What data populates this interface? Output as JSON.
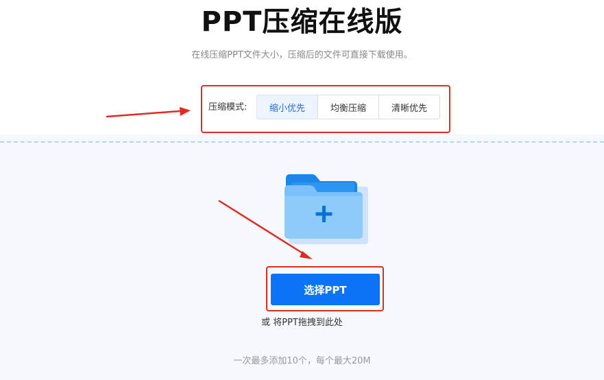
{
  "header": {
    "title": "PPT压缩在线版",
    "subtitle": "在线压缩PPT文件大小，压缩后的文件可直接下载使用。"
  },
  "compression_mode": {
    "label": "压缩模式:",
    "options": [
      {
        "label": "缩小优先",
        "selected": true
      },
      {
        "label": "均衡压缩",
        "selected": false
      },
      {
        "label": "清晰优先",
        "selected": false
      }
    ]
  },
  "upload": {
    "button_label": "选择PPT",
    "drag_hint": "或 将PPT拖拽到此处",
    "limit_note": "一次最多添加10个，每个最大20M"
  },
  "colors": {
    "accent": "#0b73f4",
    "annotation": "#e02b20",
    "selected_option_bg": "#eef4fd",
    "selected_option_text": "#1e6fe0",
    "upload_zone_bg": "#f5f8fd"
  },
  "icons": {
    "upload_folder": "folder-plus-icon"
  }
}
